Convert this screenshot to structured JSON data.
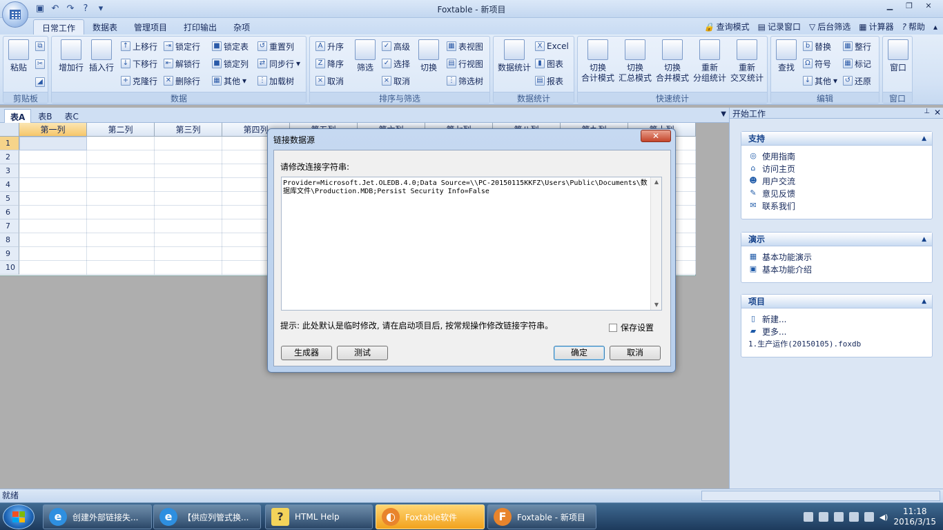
{
  "window": {
    "title": "Foxtable - 新项目",
    "controls": [
      "minimize-icon",
      "restore-icon",
      "close-icon"
    ]
  },
  "ribbon": {
    "tabs": [
      "日常工作",
      "数据表",
      "管理项目",
      "打印输出",
      "杂项"
    ],
    "right_items": [
      "查询模式",
      "记录窗口",
      "后台筛选",
      "计算器",
      "帮助"
    ],
    "groups": {
      "clipboard": {
        "label": "剪贴板",
        "paste": "粘贴"
      },
      "data": {
        "label": "数据",
        "add_row": "增加行",
        "insert_row": "插入行",
        "move_up": "上移行",
        "move_down": "下移行",
        "clone_row": "克隆行",
        "lock_row": "锁定行",
        "unlock_row": "解锁行",
        "delete_row": "删除行",
        "lock_table": "锁定表",
        "lock_column": "锁定列",
        "other": "其他",
        "reset_column": "重置列",
        "sync_column": "同步行",
        "load_tree": "加载树"
      },
      "sort": {
        "label": "排序与筛选",
        "asc": "升序",
        "desc": "降序",
        "cancel": "取消",
        "filter": "筛选",
        "advanced": "高级",
        "select": "选择",
        "cancel2": "取消",
        "toggle": "切换",
        "table_view": "表视图",
        "row_view": "行视图",
        "filter_tree": "筛选树"
      },
      "stats": {
        "label": "数据统计",
        "data_stats": "数据统计",
        "excel": "Excel",
        "chart": "图表",
        "report": "报表"
      },
      "quick": {
        "label": "快速统计",
        "b1": [
          "切换",
          "合计模式"
        ],
        "b2": [
          "切换",
          "汇总模式"
        ],
        "b3": [
          "切换",
          "合并模式"
        ],
        "b4": [
          "重新",
          "分组统计"
        ],
        "b5": [
          "重新",
          "交叉统计"
        ]
      },
      "edit": {
        "label": "编辑",
        "find": "查找",
        "replace": "替换",
        "symbol": "符号",
        "other": "其他",
        "trim": "整行",
        "mark": "标记",
        "restore": "还原"
      },
      "window": {
        "label": "窗口",
        "window": "窗口"
      }
    }
  },
  "sheets": [
    "表A",
    "表B",
    "表C"
  ],
  "grid": {
    "columns": [
      "第一列",
      "第二列",
      "第三列",
      "第四列",
      "第五列",
      "第六列",
      "第七列",
      "第八列",
      "第九列",
      "第十列"
    ],
    "rows": [
      "1",
      "2",
      "3",
      "4",
      "5",
      "6",
      "7",
      "8",
      "9",
      "10"
    ]
  },
  "panel": {
    "title": "开始工作",
    "support": {
      "title": "支持",
      "items": [
        "使用指南",
        "访问主页",
        "用户交流",
        "意见反馈",
        "联系我们"
      ]
    },
    "demo": {
      "title": "演示",
      "items": [
        "基本功能演示",
        "基本功能介绍"
      ]
    },
    "project": {
      "title": "项目",
      "items": [
        "新建...",
        "更多..."
      ],
      "recent": "1.生产运作(20150105).foxdb"
    }
  },
  "status": {
    "text": "就绪"
  },
  "dialog": {
    "title": "链接数据源",
    "prompt": "请修改连接字符串:",
    "connection_string": "Provider=Microsoft.Jet.OLEDB.4.0;Data Source=\\\\PC-20150115KKFZ\\Users\\Public\\Documents\\数据库文件\\Production.MDB;Persist Security Info=False",
    "hint": "提示: 此处默认是临时修改, 请在启动项目后, 按常规操作修改链接字符串。",
    "save_label": "保存设置",
    "save_checked": false,
    "buttons": {
      "builder": "生成器",
      "test": "测试",
      "ok": "确定",
      "cancel": "取消"
    }
  },
  "taskbar": {
    "items": [
      "创建外部链接失...",
      "【供应列管式换...",
      "HTML Help",
      "Foxtable软件",
      "Foxtable - 新项目"
    ],
    "time": "11:18",
    "date": "2016/3/15"
  }
}
